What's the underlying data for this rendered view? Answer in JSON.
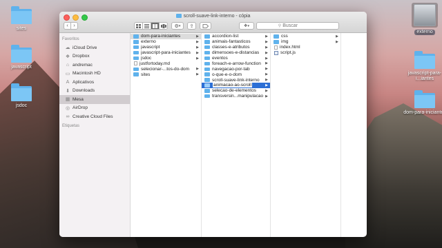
{
  "window_title": "scroll-suave-link-interno - cópia",
  "desktop": {
    "left_icons": [
      {
        "label": "sites"
      },
      {
        "label": "javascript"
      },
      {
        "label": "jsdoc"
      }
    ],
    "right_icons": [
      {
        "label": "externo"
      },
      {
        "label": "javascript-para-i...iantes"
      },
      {
        "label": "dom-para-iniciantes"
      }
    ]
  },
  "toolbar": {
    "back": "‹",
    "forward": "›",
    "search_placeholder": "Buscar"
  },
  "sidebar": {
    "favorites_heading": "Favoritos",
    "items": [
      {
        "label": "iCloud Drive",
        "icon": "cloud-icon"
      },
      {
        "label": "Dropbox",
        "icon": "dropbox-icon"
      },
      {
        "label": "andremac",
        "icon": "home-icon"
      },
      {
        "label": "Macintosh HD",
        "icon": "disk-icon"
      },
      {
        "label": "Aplicativos",
        "icon": "apps-icon"
      },
      {
        "label": "Downloads",
        "icon": "downloads-icon"
      },
      {
        "label": "Mesa",
        "icon": "desktop-icon",
        "selected": true
      },
      {
        "label": "AirDrop",
        "icon": "airdrop-icon"
      },
      {
        "label": "Creative Cloud Files",
        "icon": "creative-cloud-icon"
      }
    ],
    "tags_heading": "Etiquetas"
  },
  "columns": [
    [
      {
        "name": "dom-para-iniciantes",
        "type": "folder",
        "selected": "grey",
        "arrow": true
      },
      {
        "name": "externo",
        "type": "folder",
        "arrow": true
      },
      {
        "name": "javascript",
        "type": "folder",
        "arrow": true
      },
      {
        "name": "javascript-para-iniciantes",
        "type": "folder",
        "arrow": true
      },
      {
        "name": "jsdoc",
        "type": "folder",
        "arrow": true
      },
      {
        "name": "justfortoday.md",
        "type": "file"
      },
      {
        "name": "selecionar-...tos-do-dom",
        "type": "folder",
        "arrow": true
      },
      {
        "name": "sites",
        "type": "folder",
        "arrow": true
      }
    ],
    [
      {
        "name": "accordion-list",
        "type": "folder",
        "arrow": true
      },
      {
        "name": "animais-fantasticos",
        "type": "folder",
        "arrow": true
      },
      {
        "name": "classes-e-atributos",
        "type": "folder",
        "arrow": true
      },
      {
        "name": "dimensoes-e-distancias",
        "type": "folder",
        "arrow": true
      },
      {
        "name": "eventos",
        "type": "folder",
        "arrow": true
      },
      {
        "name": "foreach-e-arrow-function",
        "type": "folder",
        "arrow": true
      },
      {
        "name": "navegacao-por-tab",
        "type": "folder",
        "arrow": true
      },
      {
        "name": "o-que-e-o-dom",
        "type": "folder",
        "arrow": true
      },
      {
        "name": "scroll-suave-link-interno",
        "type": "folder",
        "arrow": true
      },
      {
        "name": "animacao-ao-scroll",
        "type": "folder",
        "selected": "blue",
        "editing": true,
        "arrow": true
      },
      {
        "name": "selecao-de-elementos",
        "type": "folder",
        "arrow": true
      },
      {
        "name": "transversin...manipulacao",
        "type": "folder",
        "arrow": true
      }
    ],
    [
      {
        "name": "css",
        "type": "folder",
        "arrow": true
      },
      {
        "name": "img",
        "type": "folder",
        "arrow": true
      },
      {
        "name": "index.html",
        "type": "file"
      },
      {
        "name": "script.js",
        "type": "js"
      }
    ],
    []
  ]
}
